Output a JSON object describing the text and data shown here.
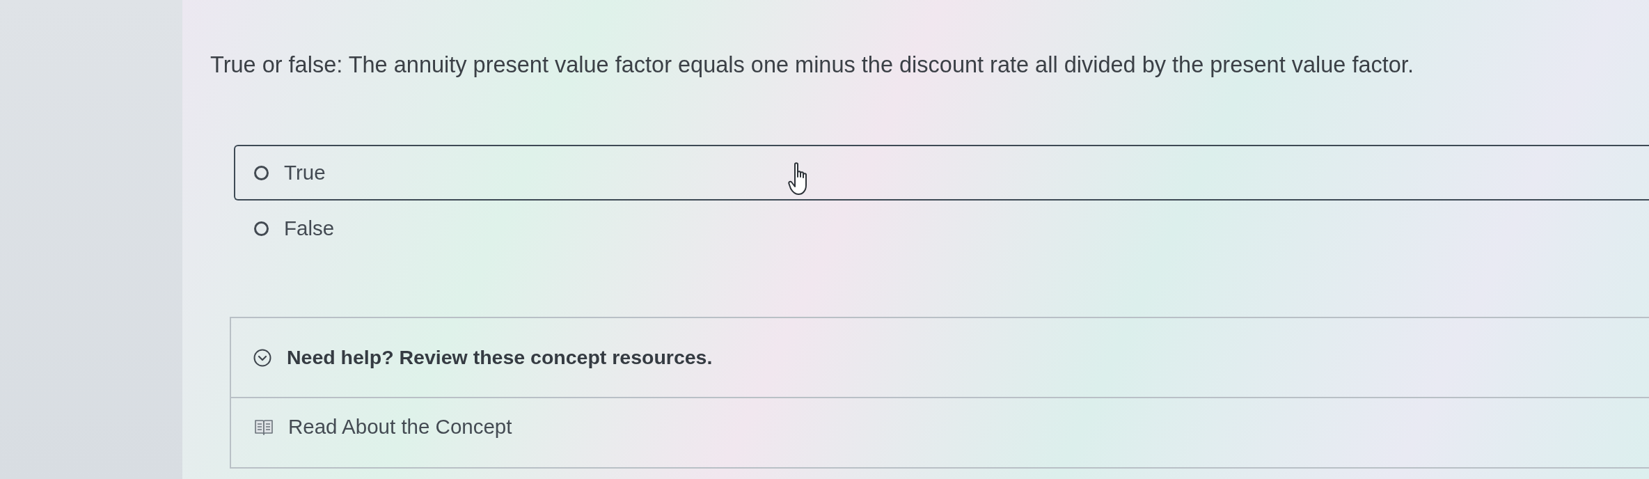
{
  "question": {
    "text": "True or false: The annuity present value factor equals one minus the discount rate all divided by the present value factor."
  },
  "options": [
    {
      "label": "True",
      "selected": false,
      "hovered": true
    },
    {
      "label": "False",
      "selected": false,
      "hovered": false
    }
  ],
  "help": {
    "title": "Need help? Review these concept resources.",
    "expanded": true,
    "resources": [
      {
        "label": "Read About the Concept"
      }
    ]
  }
}
